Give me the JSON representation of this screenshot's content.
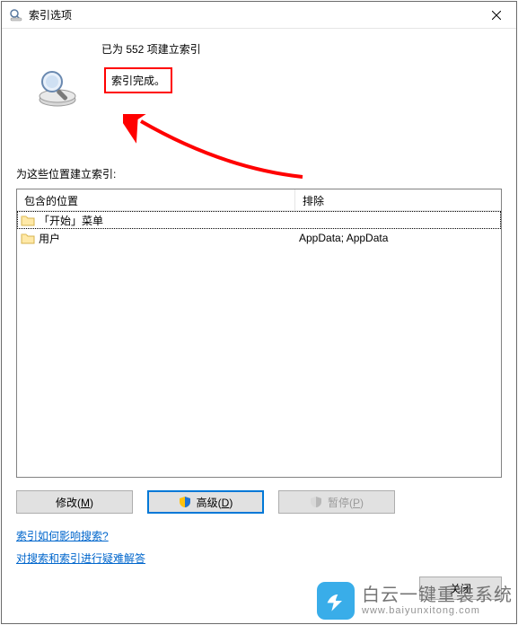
{
  "window": {
    "title": "索引选项"
  },
  "status": {
    "indexed_count_line": "已为 552 项建立索引",
    "complete_text": "索引完成。"
  },
  "locations": {
    "section_label": "为这些位置建立索引:",
    "columns": {
      "included": "包含的位置",
      "excluded": "排除"
    },
    "rows": [
      {
        "name": "「开始」菜单",
        "excluded": ""
      },
      {
        "name": "用户",
        "excluded": "AppData; AppData"
      }
    ]
  },
  "buttons": {
    "modify": "修改(M)",
    "advanced": "高级(D)",
    "pause": "暂停(P)",
    "close": "关闭"
  },
  "links": {
    "how_affect": "索引如何影响搜索?",
    "troubleshoot": "对搜索和索引进行疑难解答"
  },
  "watermark": {
    "line1": "白云一键重装系统",
    "line2": "www.baiyunxitong.com"
  }
}
